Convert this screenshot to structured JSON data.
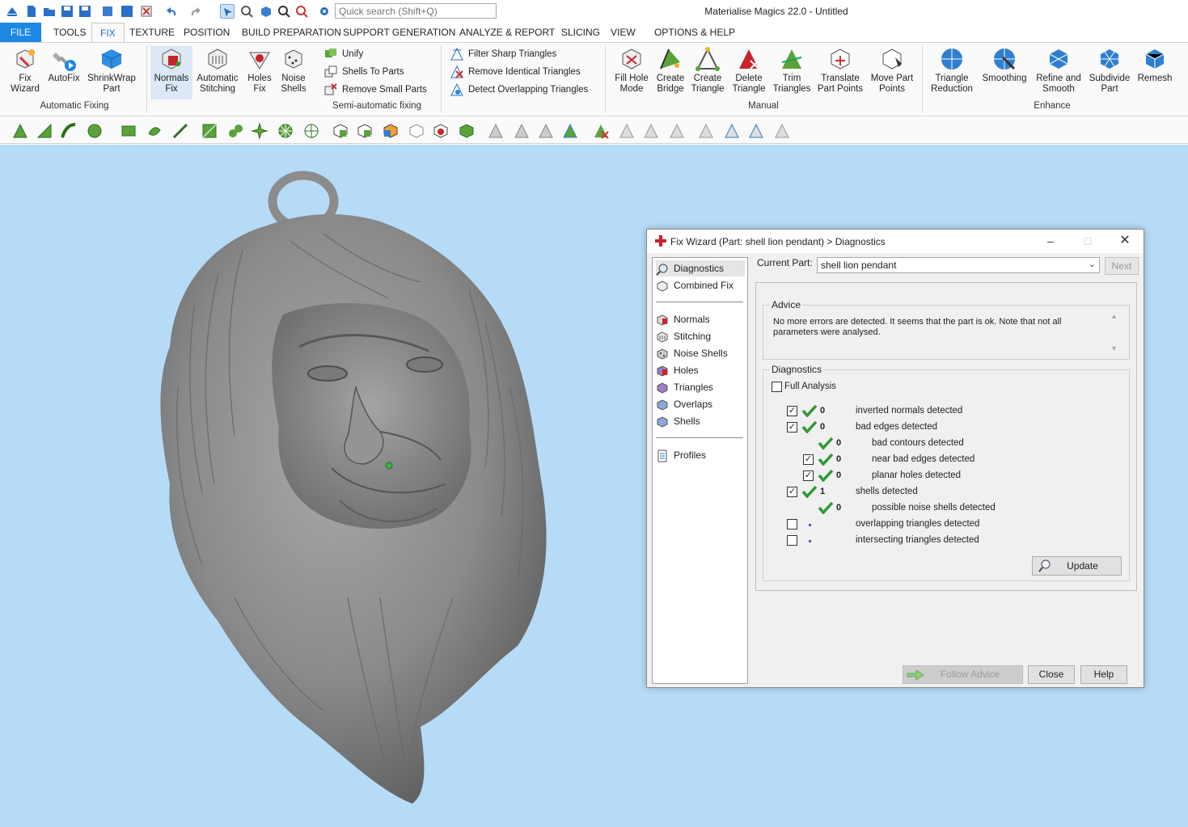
{
  "app": {
    "title": "Materialise Magics 22.0 - Untitled"
  },
  "search": {
    "placeholder": "Quick search (Shift+Q)"
  },
  "menu": {
    "tabs": [
      "FILE",
      "TOOLS",
      "FIX",
      "TEXTURE",
      "POSITION",
      "BUILD PREPARATION",
      "SUPPORT GENERATION",
      "ANALYZE & REPORT",
      "SLICING",
      "VIEW",
      "OPTIONS & HELP"
    ],
    "active": "FIX"
  },
  "ribbon": {
    "automatic_fixing": {
      "label": "Automatic Fixing",
      "fix_wizard": "Fix\nWizard",
      "autofix": "AutoFix",
      "shrinkwrap": "ShrinkWrap\nPart"
    },
    "semi_automatic": {
      "label": "Semi-automatic fixing",
      "normals_fix": "Normals\nFix",
      "auto_stitching": "Automatic\nStitching",
      "holes_fix": "Holes\nFix",
      "noise_shells": "Noise\nShells",
      "unify": "Unify",
      "shells_to_parts": "Shells To Parts",
      "remove_small_parts": "Remove Small Parts",
      "filter_sharp": "Filter Sharp Triangles",
      "remove_identical": "Remove Identical Triangles",
      "detect_overlapping": "Detect Overlapping Triangles"
    },
    "manual": {
      "label": "Manual",
      "fill_hole_mode": "Fill Hole\nMode",
      "create_bridge": "Create\nBridge",
      "create_triangle": "Create\nTriangle",
      "delete_triangle": "Delete\nTriangle",
      "trim_triangles": "Trim\nTriangles",
      "translate_part_points": "Translate\nPart Points",
      "move_part_points": "Move Part\nPoints"
    },
    "enhance": {
      "label": "Enhance",
      "triangle_reduction": "Triangle\nReduction",
      "smoothing": "Smoothing",
      "refine_smooth": "Refine and\nSmooth",
      "subdivide_part": "Subdivide\nPart",
      "remesh": "Remesh"
    }
  },
  "dialog": {
    "title": "Fix Wizard (Part: shell  lion pendant) > Diagnostics",
    "nav": [
      "Diagnostics",
      "Combined Fix",
      "Normals",
      "Stitching",
      "Noise Shells",
      "Holes",
      "Triangles",
      "Overlaps",
      "Shells",
      "Profiles"
    ],
    "current_part_label": "Current Part:",
    "current_part_value": "shell  lion pendant",
    "next_label": "Next",
    "advice_caption": "Advice",
    "advice_text": "No more errors are detected. It seems that the part is ok. Note that not all parameters were analysed.",
    "diagnostics_caption": "Diagnostics",
    "full_analysis_label": "Full Analysis",
    "rows": [
      {
        "checkbox": true,
        "checked": true,
        "status": "ok",
        "count": "0",
        "label": "inverted normals detected",
        "indent": 0
      },
      {
        "checkbox": true,
        "checked": true,
        "status": "ok",
        "count": "0",
        "label": "bad edges detected",
        "indent": 0
      },
      {
        "checkbox": false,
        "checked": false,
        "status": "ok",
        "count": "0",
        "label": "bad contours detected",
        "indent": 1
      },
      {
        "checkbox": true,
        "checked": true,
        "status": "ok",
        "count": "0",
        "label": "near bad edges detected",
        "indent": 1
      },
      {
        "checkbox": true,
        "checked": true,
        "status": "ok",
        "count": "0",
        "label": "planar holes detected",
        "indent": 1
      },
      {
        "checkbox": true,
        "checked": true,
        "status": "ok",
        "count": "1",
        "label": "shells detected",
        "indent": 0
      },
      {
        "checkbox": false,
        "checked": false,
        "status": "ok",
        "count": "0",
        "label": "possible noise shells detected",
        "indent": 1
      },
      {
        "checkbox": true,
        "checked": false,
        "status": "pending",
        "count": "",
        "label": "overlapping triangles detected",
        "indent": 0
      },
      {
        "checkbox": true,
        "checked": false,
        "status": "pending",
        "count": "",
        "label": "intersecting triangles detected",
        "indent": 0
      }
    ],
    "update_label": "Update",
    "follow_advice_label": "Follow Advice",
    "close_label": "Close",
    "help_label": "Help"
  },
  "colors": {
    "viewport_bg": "#b6dbf7",
    "accent": "#1e88e5",
    "ok_green": "#2e9a2e",
    "model_gray": "#8a8a8a"
  }
}
